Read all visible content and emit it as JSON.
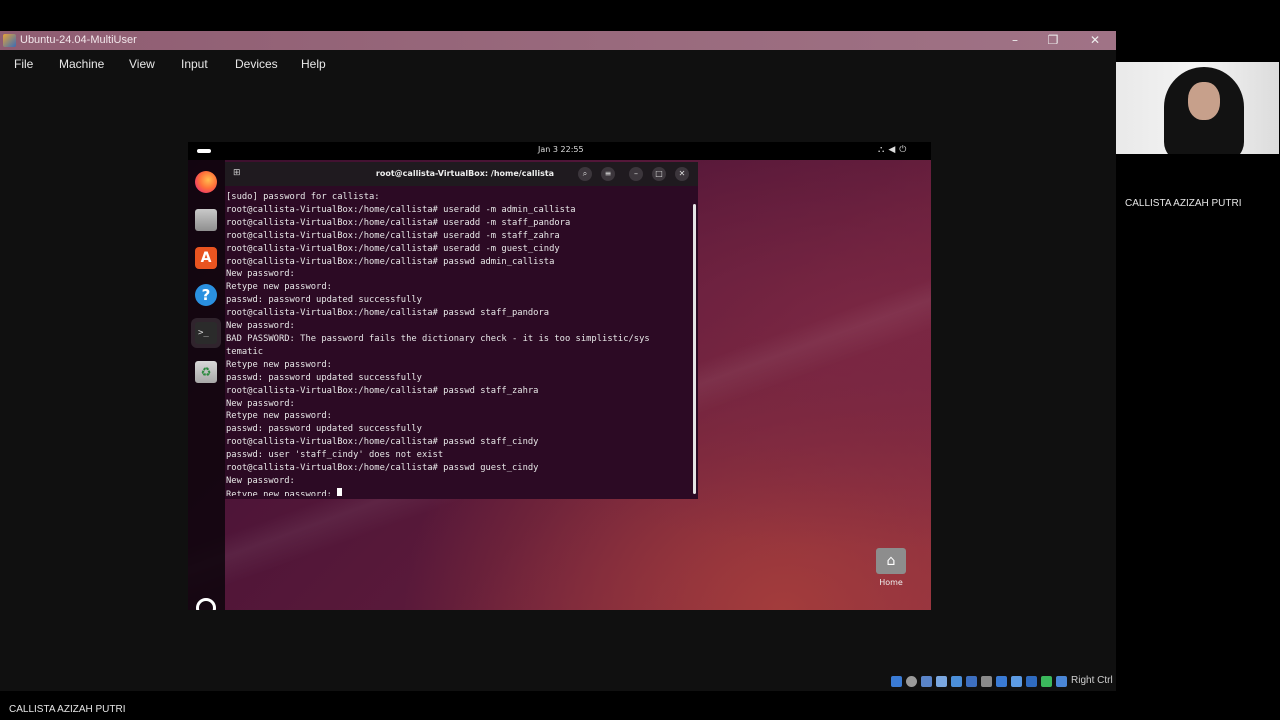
{
  "vbox": {
    "title": "Ubuntu-24.04-MultiUser",
    "controls": {
      "minimize": "–",
      "restore": "❐",
      "close": "✕"
    },
    "menu": [
      "File",
      "Machine",
      "View",
      "Input",
      "Devices",
      "Help"
    ],
    "host_key": "Right Ctrl"
  },
  "guest": {
    "clock": "Jan 3  22:55",
    "tray_icons": [
      "network-icon",
      "volume-icon",
      "power-icon"
    ],
    "dock": [
      "firefox-icon",
      "files-icon",
      "app-center-icon",
      "help-icon",
      "terminal-icon",
      "trash-icon",
      "show-apps-icon"
    ],
    "desktop_home_label": "Home",
    "terminal": {
      "title": "root@callista-VirtualBox: /home/callista",
      "lines": [
        "[sudo] password for callista:",
        "root@callista-VirtualBox:/home/callista# useradd -m admin_callista",
        "root@callista-VirtualBox:/home/callista# useradd -m staff_pandora",
        "root@callista-VirtualBox:/home/callista# useradd -m staff_zahra",
        "root@callista-VirtualBox:/home/callista# useradd -m guest_cindy",
        "root@callista-VirtualBox:/home/callista# passwd admin_callista",
        "New password:",
        "Retype new password:",
        "passwd: password updated successfully",
        "root@callista-VirtualBox:/home/callista# passwd staff_pandora",
        "New password:",
        "BAD PASSWORD: The password fails the dictionary check - it is too simplistic/sys",
        "tematic",
        "Retype new password:",
        "passwd: password updated successfully",
        "root@callista-VirtualBox:/home/callista# passwd staff_zahra",
        "New password:",
        "Retype new password:",
        "passwd: password updated successfully",
        "root@callista-VirtualBox:/home/callista# passwd staff_cindy",
        "passwd: user 'staff_cindy' does not exist",
        "root@callista-VirtualBox:/home/callista# passwd guest_cindy",
        "New password:"
      ],
      "prompt_line": "Retype new password: "
    }
  },
  "meeting": {
    "participant_name": "CALLISTA AZIZAH PUTRI",
    "self_name": "CALLISTA AZIZAH PUTRI"
  },
  "colors": {
    "terminal_bg": "#2c0a24",
    "titlebar": "#9a6b7e",
    "ubuntu_orange": "#e95420"
  }
}
